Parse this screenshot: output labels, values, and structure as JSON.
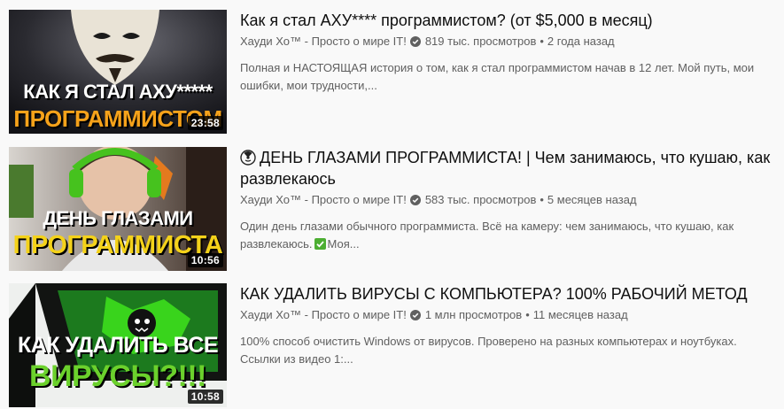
{
  "videos": [
    {
      "title": "Как я стал АХУ**** программистом? (от $5,000 в месяц)",
      "channel": "Хауди Хо™ - Просто о мире IT!",
      "views": "819 тыс. просмотров",
      "age": "2 года назад",
      "description": "Полная и НАСТОЯЩАЯ история о том, как я стал программистом начав в 12 лет. Мой путь, мои ошибки, мои трудности,...",
      "duration": "23:58",
      "thumb_line1": "КАК Я СТАЛ АХУ*****",
      "thumb_line2": "ПРОГРАММИСТОМ"
    },
    {
      "title_emoji": "radioactive-face-emoji",
      "title": "ДЕНЬ ГЛАЗАМИ ПРОГРАММИСТА! | Чем занимаюсь, что кушаю, как развлекаюсь",
      "channel": "Хауди Хо™ - Просто о мире IT!",
      "views": "583 тыс. просмотров",
      "age": "5 месяцев назад",
      "description_part1": "Один день глазами обычного программиста. Всё на камеру: чем занимаюсь, что кушаю, как развлекаюсь.",
      "description_part2": "Моя...",
      "duration": "10:56",
      "thumb_line1": "ДЕНЬ ГЛАЗАМИ",
      "thumb_line2": "ПРОГРАММИСТА"
    },
    {
      "title": "КАК УДАЛИТЬ ВИРУСЫ С КОМПЬЮТЕРА? 100% РАБОЧИЙ МЕТОД",
      "channel": "Хауди Хо™ - Просто о мире IT!",
      "views": "1 млн просмотров",
      "age": "11 месяцев назад",
      "description": "100% способ очистить Windows от вирусов. Проверено на разных компьютерах и ноутбуках. Ссылки из видео 1:...",
      "duration": "10:58",
      "thumb_line1": "КАК УДАЛИТЬ ВСЕ",
      "thumb_line2": "ВИРУСЫ?!!!"
    }
  ],
  "colors": {
    "background": "#f9f9f9",
    "title": "#0f0f0f",
    "meta": "#606060",
    "thumb_accent_orange": "#f6a21a",
    "thumb_accent_yellow": "#f4d21a",
    "thumb_accent_green": "#6bd12c"
  }
}
